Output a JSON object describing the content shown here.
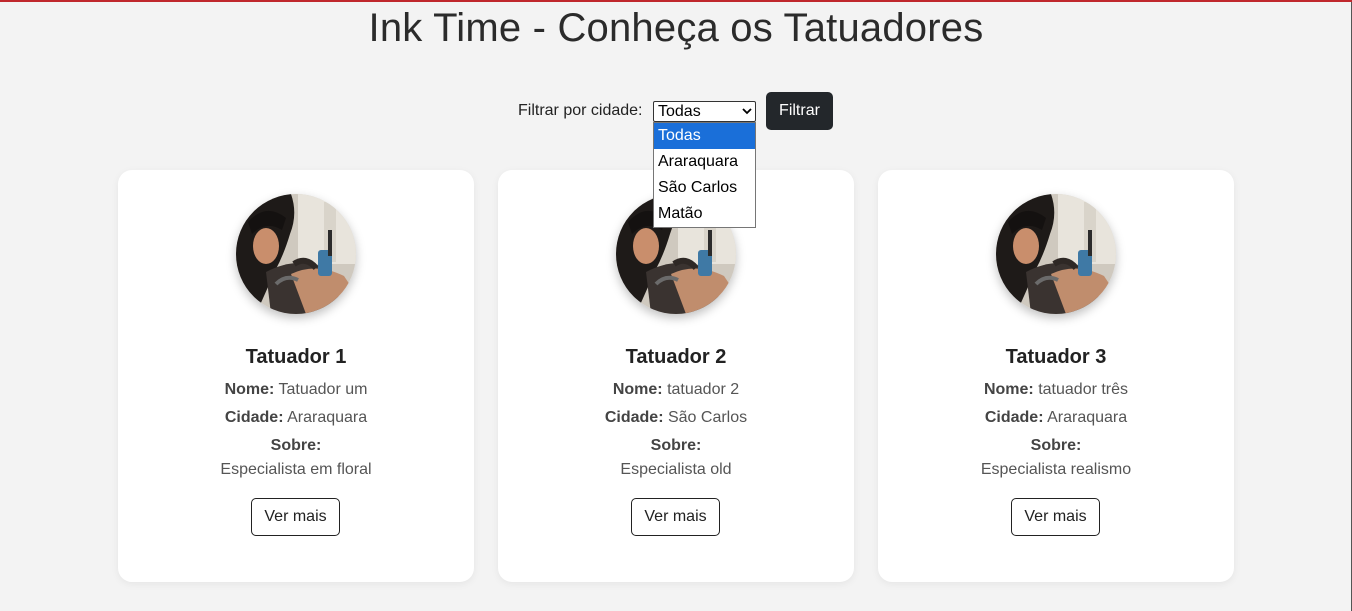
{
  "page": {
    "title": "Ink Time - Conheça os Tatuadores",
    "accent_color": "#c0282d"
  },
  "filter": {
    "label": "Filtrar por cidade:",
    "selected": "Todas",
    "button_label": "Filtrar",
    "options": [
      "Todas",
      "Araraquara",
      "São Carlos",
      "Matão"
    ],
    "highlighted_option": "Todas"
  },
  "labels": {
    "nome": "Nome:",
    "cidade": "Cidade:",
    "sobre": "Sobre:",
    "ver_mais": "Ver mais"
  },
  "cards": [
    {
      "title": "Tatuador 1",
      "nome": "Tatuador um",
      "cidade": "Araraquara",
      "sobre": "Especialista em floral"
    },
    {
      "title": "Tatuador 2",
      "nome": "tatuador 2",
      "cidade": "São Carlos",
      "sobre": "Especialista old"
    },
    {
      "title": "Tatuador 3",
      "nome": "tatuador três",
      "cidade": "Araraquara",
      "sobre": "Especialista realismo"
    }
  ],
  "icons": {
    "select_arrow": "chevron-down-icon",
    "avatar": "tattoo-artist-photo"
  }
}
